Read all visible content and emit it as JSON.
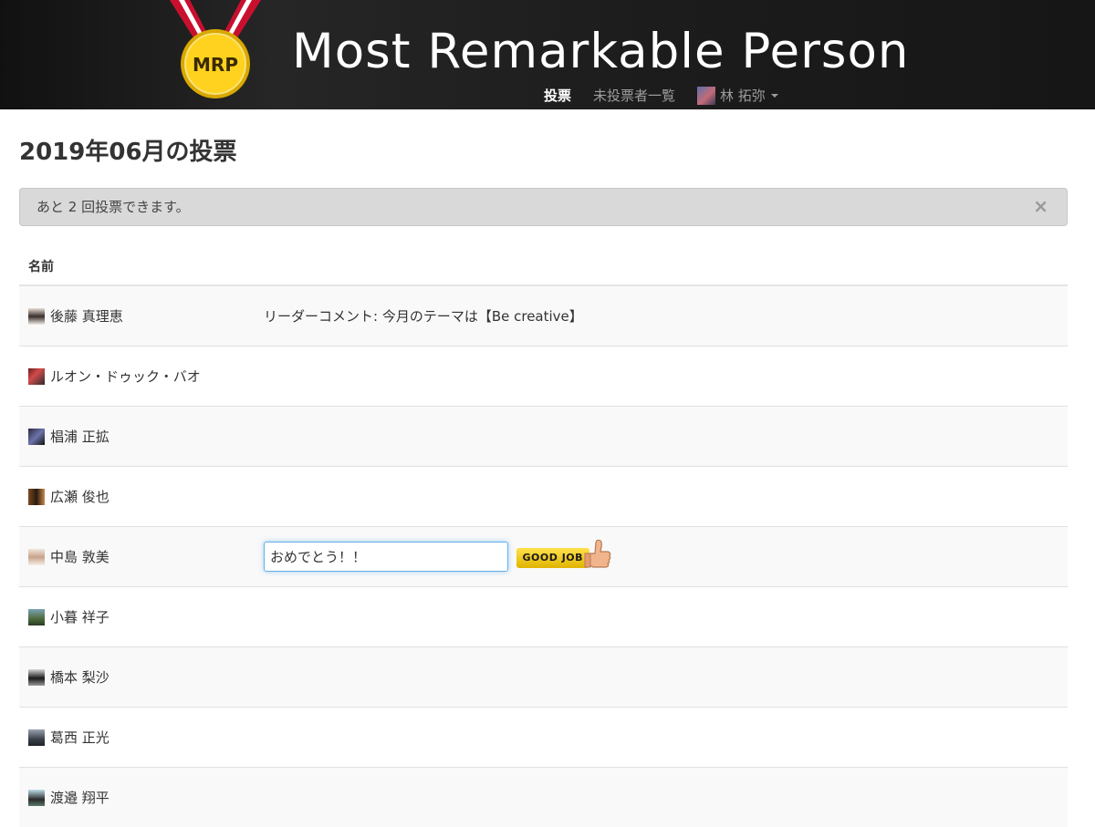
{
  "header": {
    "site_title": "Most Remarkable Person",
    "logo_text": "MRP",
    "nav": [
      {
        "label": "投票",
        "active": true
      },
      {
        "label": "未投票者一覧",
        "active": false
      }
    ],
    "user": {
      "name": "林 拓弥"
    }
  },
  "page": {
    "title": "2019年06月の投票",
    "alert": {
      "text": "あと 2 回投票できます。",
      "close": "×"
    }
  },
  "table": {
    "columns": [
      "名前"
    ],
    "rows": [
      {
        "name": "後藤 真理恵",
        "comment": "リーダーコメント: 今月のテーマは【Be creative】"
      },
      {
        "name": "ルオン・ドゥック・バオ",
        "comment": ""
      },
      {
        "name": "椙浦 正拡",
        "comment": ""
      },
      {
        "name": "広瀬 俊也",
        "comment": ""
      },
      {
        "name": "中島 敦美",
        "comment": "",
        "input_value": "おめでとう！！",
        "badge": "GOOD JOB"
      },
      {
        "name": "小暮 祥子",
        "comment": ""
      },
      {
        "name": "橋本 梨沙",
        "comment": ""
      },
      {
        "name": "葛西 正光",
        "comment": ""
      },
      {
        "name": "渡邉 翔平",
        "comment": ""
      }
    ]
  },
  "colors": {
    "header_bg": "#1b1b1b",
    "nav_active": "#ffffff",
    "nav_inactive": "#9d9d9d",
    "alert_bg": "#d9d9d9",
    "input_focus": "#66afe9",
    "badge": "#f5c400"
  }
}
